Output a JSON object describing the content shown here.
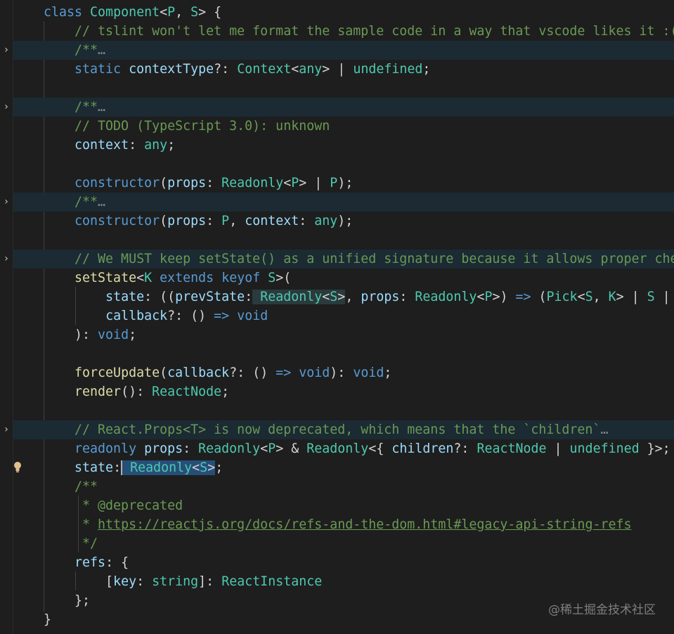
{
  "editor": {
    "lines": [
      {
        "folded": false,
        "tokens": [
          {
            "t": "class ",
            "c": "k"
          },
          {
            "t": "Component",
            "c": "t"
          },
          {
            "t": "<",
            "c": "p"
          },
          {
            "t": "P",
            "c": "t"
          },
          {
            "t": ", ",
            "c": "p"
          },
          {
            "t": "S",
            "c": "t"
          },
          {
            "t": "> {",
            "c": "p"
          }
        ]
      },
      {
        "folded": false,
        "tokens": [
          {
            "t": "    // tslint won't let me format the sample code in a way that vscode likes it :(",
            "c": "c"
          }
        ]
      },
      {
        "folded": true,
        "tokens": [
          {
            "t": "    /**",
            "c": "c"
          },
          {
            "t": "…",
            "c": "ell"
          }
        ]
      },
      {
        "folded": false,
        "tokens": [
          {
            "t": "    static ",
            "c": "k"
          },
          {
            "t": "contextType",
            "c": "v"
          },
          {
            "t": "?: ",
            "c": "p"
          },
          {
            "t": "Context",
            "c": "t"
          },
          {
            "t": "<",
            "c": "p"
          },
          {
            "t": "any",
            "c": "t"
          },
          {
            "t": "> | ",
            "c": "p"
          },
          {
            "t": "undefined",
            "c": "t"
          },
          {
            "t": ";",
            "c": "p"
          }
        ]
      },
      {
        "folded": false,
        "tokens": []
      },
      {
        "folded": true,
        "tokens": [
          {
            "t": "    /**",
            "c": "c"
          },
          {
            "t": "…",
            "c": "ell"
          }
        ]
      },
      {
        "folded": false,
        "tokens": [
          {
            "t": "    // TODO (TypeScript 3.0): unknown",
            "c": "c"
          }
        ]
      },
      {
        "folded": false,
        "tokens": [
          {
            "t": "    ",
            "c": "p"
          },
          {
            "t": "context",
            "c": "v"
          },
          {
            "t": ": ",
            "c": "p"
          },
          {
            "t": "any",
            "c": "t"
          },
          {
            "t": ";",
            "c": "p"
          }
        ]
      },
      {
        "folded": false,
        "tokens": []
      },
      {
        "folded": false,
        "tokens": [
          {
            "t": "    ",
            "c": "p"
          },
          {
            "t": "constructor",
            "c": "k"
          },
          {
            "t": "(",
            "c": "p"
          },
          {
            "t": "props",
            "c": "v"
          },
          {
            "t": ": ",
            "c": "p"
          },
          {
            "t": "Readonly",
            "c": "t"
          },
          {
            "t": "<",
            "c": "p"
          },
          {
            "t": "P",
            "c": "t"
          },
          {
            "t": "> | ",
            "c": "p"
          },
          {
            "t": "P",
            "c": "t"
          },
          {
            "t": ");",
            "c": "p"
          }
        ]
      },
      {
        "folded": true,
        "tokens": [
          {
            "t": "    /**",
            "c": "c"
          },
          {
            "t": "…",
            "c": "ell"
          }
        ]
      },
      {
        "folded": false,
        "tokens": [
          {
            "t": "    ",
            "c": "p"
          },
          {
            "t": "constructor",
            "c": "k"
          },
          {
            "t": "(",
            "c": "p"
          },
          {
            "t": "props",
            "c": "v"
          },
          {
            "t": ": ",
            "c": "p"
          },
          {
            "t": "P",
            "c": "t"
          },
          {
            "t": ", ",
            "c": "p"
          },
          {
            "t": "context",
            "c": "v"
          },
          {
            "t": ": ",
            "c": "p"
          },
          {
            "t": "any",
            "c": "t"
          },
          {
            "t": ");",
            "c": "p"
          }
        ]
      },
      {
        "folded": false,
        "tokens": []
      },
      {
        "folded": true,
        "tokens": [
          {
            "t": "    // We MUST keep setState() as a unified signature because it allows proper che",
            "c": "c"
          }
        ]
      },
      {
        "folded": false,
        "tokens": [
          {
            "t": "    ",
            "c": "p"
          },
          {
            "t": "setState",
            "c": "f"
          },
          {
            "t": "<",
            "c": "p"
          },
          {
            "t": "K",
            "c": "t"
          },
          {
            "t": " extends ",
            "c": "k"
          },
          {
            "t": "keyof ",
            "c": "k"
          },
          {
            "t": "S",
            "c": "t"
          },
          {
            "t": ">(",
            "c": "p"
          }
        ]
      },
      {
        "folded": false,
        "tokens": [
          {
            "t": "        ",
            "c": "p"
          },
          {
            "t": "state",
            "c": "v"
          },
          {
            "t": ": ((",
            "c": "p"
          },
          {
            "t": "prevState",
            "c": "v"
          },
          {
            "t": ":",
            "c": "p"
          },
          {
            "t": " Readonly",
            "c": "t hl"
          },
          {
            "t": "<",
            "c": "p hl"
          },
          {
            "t": "S",
            "c": "t hl"
          },
          {
            "t": ">",
            "c": "p hl"
          },
          {
            "t": ", ",
            "c": "p"
          },
          {
            "t": "props",
            "c": "v"
          },
          {
            "t": ": ",
            "c": "p"
          },
          {
            "t": "Readonly",
            "c": "t"
          },
          {
            "t": "<",
            "c": "p"
          },
          {
            "t": "P",
            "c": "t"
          },
          {
            "t": ">) ",
            "c": "p"
          },
          {
            "t": "=>",
            "c": "k"
          },
          {
            "t": " (",
            "c": "p"
          },
          {
            "t": "Pick",
            "c": "t"
          },
          {
            "t": "<",
            "c": "p"
          },
          {
            "t": "S",
            "c": "t"
          },
          {
            "t": ", ",
            "c": "p"
          },
          {
            "t": "K",
            "c": "t"
          },
          {
            "t": "> | ",
            "c": "p"
          },
          {
            "t": "S",
            "c": "t"
          },
          {
            "t": " |",
            "c": "p"
          }
        ]
      },
      {
        "folded": false,
        "tokens": [
          {
            "t": "        ",
            "c": "p"
          },
          {
            "t": "callback",
            "c": "v"
          },
          {
            "t": "?: () ",
            "c": "p"
          },
          {
            "t": "=>",
            "c": "k"
          },
          {
            "t": " ",
            "c": "p"
          },
          {
            "t": "void",
            "c": "k"
          }
        ]
      },
      {
        "folded": false,
        "tokens": [
          {
            "t": "    ): ",
            "c": "p"
          },
          {
            "t": "void",
            "c": "k"
          },
          {
            "t": ";",
            "c": "p"
          }
        ]
      },
      {
        "folded": false,
        "tokens": []
      },
      {
        "folded": false,
        "tokens": [
          {
            "t": "    ",
            "c": "p"
          },
          {
            "t": "forceUpdate",
            "c": "f"
          },
          {
            "t": "(",
            "c": "p"
          },
          {
            "t": "callback",
            "c": "v"
          },
          {
            "t": "?: () ",
            "c": "p"
          },
          {
            "t": "=>",
            "c": "k"
          },
          {
            "t": " ",
            "c": "p"
          },
          {
            "t": "void",
            "c": "k"
          },
          {
            "t": "): ",
            "c": "p"
          },
          {
            "t": "void",
            "c": "k"
          },
          {
            "t": ";",
            "c": "p"
          }
        ]
      },
      {
        "folded": false,
        "tokens": [
          {
            "t": "    ",
            "c": "p"
          },
          {
            "t": "render",
            "c": "f"
          },
          {
            "t": "(): ",
            "c": "p"
          },
          {
            "t": "ReactNode",
            "c": "t"
          },
          {
            "t": ";",
            "c": "p"
          }
        ]
      },
      {
        "folded": false,
        "tokens": []
      },
      {
        "folded": true,
        "tokens": [
          {
            "t": "    // React.Props<T> is now deprecated, which means that the `children`",
            "c": "c"
          },
          {
            "t": "…",
            "c": "ell"
          }
        ]
      },
      {
        "folded": false,
        "tokens": [
          {
            "t": "    readonly ",
            "c": "k"
          },
          {
            "t": "props",
            "c": "v"
          },
          {
            "t": ": ",
            "c": "p"
          },
          {
            "t": "Readonly",
            "c": "t"
          },
          {
            "t": "<",
            "c": "p"
          },
          {
            "t": "P",
            "c": "t"
          },
          {
            "t": "> & ",
            "c": "p"
          },
          {
            "t": "Readonly",
            "c": "t"
          },
          {
            "t": "<{ ",
            "c": "p"
          },
          {
            "t": "children",
            "c": "v"
          },
          {
            "t": "?: ",
            "c": "p"
          },
          {
            "t": "ReactNode",
            "c": "t"
          },
          {
            "t": " | ",
            "c": "p"
          },
          {
            "t": "undefined",
            "c": "t"
          },
          {
            "t": " }>;",
            "c": "p"
          }
        ]
      },
      {
        "folded": false,
        "bulb": true,
        "tokens": [
          {
            "t": "    ",
            "c": "p"
          },
          {
            "t": "state",
            "c": "v"
          },
          {
            "t": ":",
            "c": "p"
          },
          {
            "t": " ",
            "c": "p sel cursor"
          },
          {
            "t": "Readonly",
            "c": "t sel"
          },
          {
            "t": "<",
            "c": "p sel"
          },
          {
            "t": "S",
            "c": "t sel"
          },
          {
            "t": ">",
            "c": "p sel"
          },
          {
            "t": ";",
            "c": "p"
          }
        ]
      },
      {
        "folded": false,
        "tokens": [
          {
            "t": "    /**",
            "c": "c"
          }
        ]
      },
      {
        "folded": false,
        "tokens": [
          {
            "t": "     * @deprecated",
            "c": "c"
          }
        ]
      },
      {
        "folded": false,
        "tokens": [
          {
            "t": "     * ",
            "c": "c"
          },
          {
            "t": "https://reactjs.org/docs/refs-and-the-dom.html#legacy-api-string-refs",
            "c": "cu"
          }
        ]
      },
      {
        "folded": false,
        "tokens": [
          {
            "t": "     */",
            "c": "c"
          }
        ]
      },
      {
        "folded": false,
        "tokens": [
          {
            "t": "    ",
            "c": "p"
          },
          {
            "t": "refs",
            "c": "v"
          },
          {
            "t": ": {",
            "c": "p"
          }
        ]
      },
      {
        "folded": false,
        "tokens": [
          {
            "t": "        [",
            "c": "p"
          },
          {
            "t": "key",
            "c": "v"
          },
          {
            "t": ": ",
            "c": "p"
          },
          {
            "t": "string",
            "c": "t"
          },
          {
            "t": "]: ",
            "c": "p"
          },
          {
            "t": "ReactInstance",
            "c": "t"
          }
        ]
      },
      {
        "folded": false,
        "tokens": [
          {
            "t": "    };",
            "c": "p"
          }
        ]
      },
      {
        "folded": false,
        "tokens": [
          {
            "t": "}",
            "c": "p"
          }
        ]
      }
    ]
  },
  "fold_icon": "chevron-right-icon",
  "fold_glyph": "›",
  "watermark": "@稀土掘金技术社区"
}
